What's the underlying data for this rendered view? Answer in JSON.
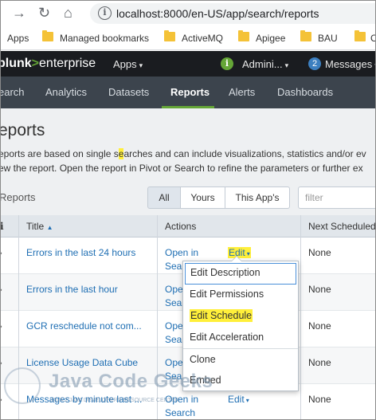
{
  "browser": {
    "url": "localhost:8000/en-US/app/search/reports",
    "back_icon": "arrow-right-icon",
    "reload_icon": "reload-icon",
    "home_icon": "home-icon",
    "info_icon": "i",
    "bookmarks": [
      {
        "label": "Apps",
        "icon": "apps-grid-icon"
      },
      {
        "label": "Managed bookmarks",
        "icon": "folder-icon"
      },
      {
        "label": "ActiveMQ",
        "icon": "folder-icon"
      },
      {
        "label": "Apigee",
        "icon": "folder-icon"
      },
      {
        "label": "BAU",
        "icon": "folder-icon"
      },
      {
        "label": "C",
        "icon": "folder-icon"
      }
    ]
  },
  "topbar": {
    "logo_prefix": "plunk",
    "logo_gt": ">",
    "logo_suffix": "enterprise",
    "apps": "Apps",
    "admin": "Admini...",
    "admin_badge": "i",
    "messages_count": "2",
    "messages": "Messages",
    "caret": "▾"
  },
  "navbar": {
    "items": [
      "earch",
      "Analytics",
      "Datasets",
      "Reports",
      "Alerts",
      "Dashboards"
    ],
    "active": "Reports"
  },
  "page": {
    "title": "eports",
    "desc_line1_pre": "eports are based on single s",
    "desc_line1_hl": "e",
    "desc_line1_post": "arches and can include visualizations, statistics and/or ev",
    "desc_line2": "ew the report. Open the report in Pivot or Search to refine the parameters or further ex",
    "count_label": "Reports",
    "filters": [
      "All",
      "Yours",
      "This App's"
    ],
    "filter_placeholder": "filter"
  },
  "table": {
    "headers": {
      "i": "i",
      "title": "Title",
      "sort": "▲",
      "actions": "Actions",
      "next": "Next Scheduled"
    },
    "rows": [
      {
        "title": "Errors in the last 24 hours",
        "open": "Open in",
        "search": "Searc",
        "edit": "Edit",
        "next": "None"
      },
      {
        "title": "Errors in the last hour",
        "open": "Open",
        "search": "Sea",
        "edit": "",
        "next": "None"
      },
      {
        "title": "GCR reschedule not com...",
        "open": "Ope",
        "search": "Sea",
        "edit": "",
        "next": "None"
      },
      {
        "title": "License Usage Data Cube",
        "open": "Ope",
        "search": "Sea",
        "edit": "",
        "next": "None"
      },
      {
        "title": "Messages by minute last ...",
        "open": "Open in",
        "search": "Search",
        "edit": "Edit",
        "next": "None"
      }
    ],
    "chevron": "›"
  },
  "menu": {
    "items": [
      "Edit Description",
      "Edit Permissions",
      "Edit Schedule",
      "Edit Acceleration",
      "Clone",
      "Embed"
    ],
    "highlighted": "Edit Schedule",
    "focused": "Edit Description"
  },
  "watermark": {
    "title": "Java Code Geeks",
    "subtitle": "JAVA 2 JAVA DEVELOPERS RESOURCE CENTER"
  }
}
